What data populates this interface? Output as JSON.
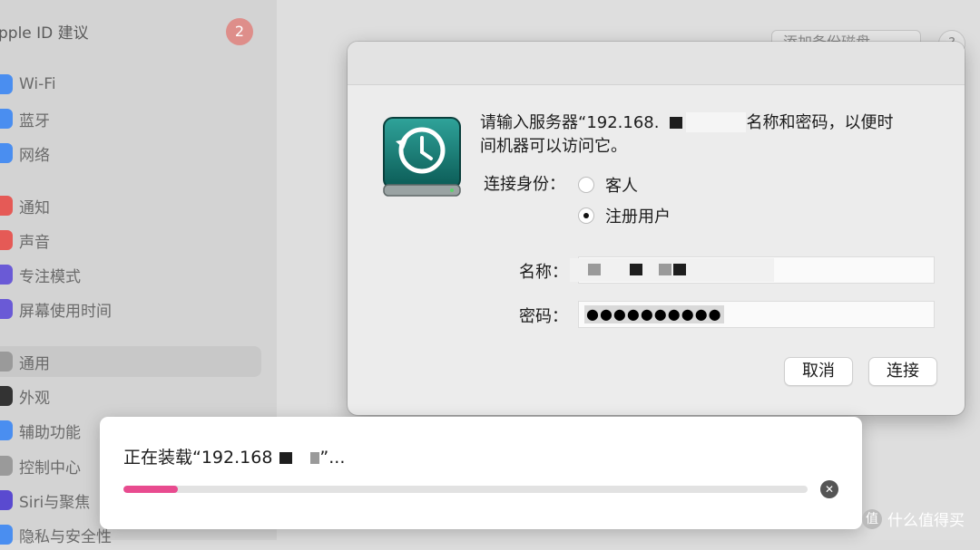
{
  "sidebar": {
    "title": "pple ID 建议",
    "badge": "2",
    "items": [
      {
        "label": "Wi-Fi",
        "color": "#4a8ef0",
        "icon": "wifi-icon"
      },
      {
        "label": "蓝牙",
        "color": "#4a8ef0",
        "icon": "bluetooth-icon"
      },
      {
        "label": "网络",
        "color": "#4a8ef0",
        "icon": "globe-icon"
      },
      {
        "label": "通知",
        "color": "#e55a56",
        "icon": "bell-icon"
      },
      {
        "label": "声音",
        "color": "#e55a56",
        "icon": "speaker-icon"
      },
      {
        "label": "专注模式",
        "color": "#6a5ad6",
        "icon": "moon-icon"
      },
      {
        "label": "屏幕使用时间",
        "color": "#6a5ad6",
        "icon": "hourglass-icon"
      },
      {
        "label": "通用",
        "color": "#9a9a9a",
        "icon": "gear-icon",
        "active": true
      },
      {
        "label": "外观",
        "color": "#333333",
        "icon": "appearance-icon"
      },
      {
        "label": "辅助功能",
        "color": "#4a8ef0",
        "icon": "accessibility-icon"
      },
      {
        "label": "控制中心",
        "color": "#9a9a9a",
        "icon": "switches-icon"
      },
      {
        "label": "Siri与聚焦",
        "color": "#5a4ad0",
        "icon": "siri-icon"
      },
      {
        "label": "隐私与安全性",
        "color": "#4a8ef0",
        "icon": "hand-icon"
      }
    ]
  },
  "toolbar": {
    "add_disk_label": "添加备份磁盘...",
    "help_label": "?"
  },
  "dialog": {
    "message_part1": "请输入服务器“192.168.",
    "message_part2": "名称和密码，以便时",
    "message_line2": "间机器可以访问它。",
    "connect_as_label": "连接身份：",
    "radio_guest": "客人",
    "radio_registered": "注册用户",
    "selected": "注册用户",
    "name_label": "名称：",
    "password_label": "密码：",
    "password_value": "●●●●●●●●●●",
    "cancel_label": "取消",
    "connect_label": "连接"
  },
  "progress": {
    "text_part1": "正在装载“192.168",
    "text_part2": "”...",
    "percent": 8,
    "stop_icon": "✕",
    "accent": "#e84b8f"
  },
  "watermark": {
    "text": "什么值得买",
    "logo": "值"
  }
}
